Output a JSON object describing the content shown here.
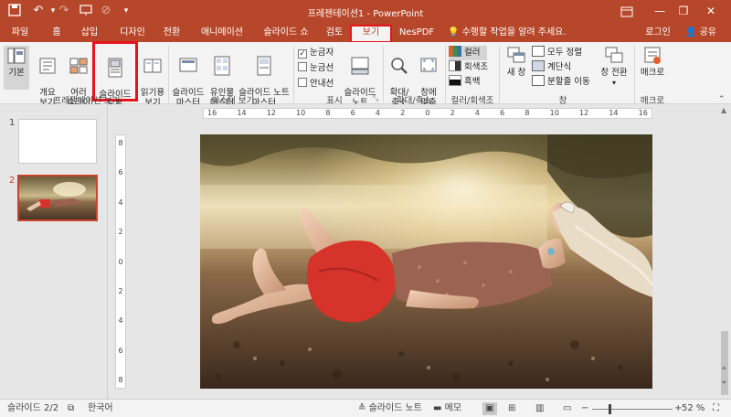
{
  "window": {
    "title": "프레젠테이션1 - PowerPoint",
    "controls": {
      "minimize": "—",
      "restore": "❐",
      "close": "✕"
    }
  },
  "tabs": [
    "파일",
    "홈",
    "삽입",
    "디자인",
    "전환",
    "애니메이션",
    "슬라이드 쇼",
    "검토",
    "보기",
    "NesPDF"
  ],
  "active_tab": "보기",
  "tell_me": "수행할 작업을 알려 주세요.",
  "account": {
    "login": "로그인",
    "share": "공유"
  },
  "ribbon": {
    "presentation_views": {
      "label": "프레젠테이션 보기",
      "buttons": [
        {
          "label": "기본"
        },
        {
          "label": "개요\n보기"
        },
        {
          "label": "여러\n슬라이드"
        },
        {
          "label": "슬라이드\n노트"
        },
        {
          "label": "읽기용\n보기"
        }
      ]
    },
    "master_views": {
      "label": "마스터 보기",
      "buttons": [
        {
          "label": "슬라이드\n마스터"
        },
        {
          "label": "유인물\n마스터"
        },
        {
          "label": "슬라이드 노트\n마스터"
        }
      ]
    },
    "show": {
      "label": "표시",
      "checks": [
        {
          "label": "눈금자",
          "checked": true
        },
        {
          "label": "눈금선",
          "checked": false
        },
        {
          "label": "안내선",
          "checked": false
        }
      ],
      "notes_button": "슬라이드\n노트"
    },
    "zoom": {
      "label": "확대/축소",
      "buttons": [
        {
          "label": "확대/\n축소"
        },
        {
          "label": "창에\n맞춤"
        }
      ]
    },
    "color": {
      "label": "컬러/회색조",
      "items": [
        {
          "label": "컬러",
          "color": "#e06030"
        },
        {
          "label": "회색조",
          "color": "#909090"
        },
        {
          "label": "흑백",
          "color": "#111111"
        }
      ]
    },
    "window": {
      "label": "창",
      "new_window": "새 창",
      "items": [
        "모두 정렬",
        "계단식",
        "분할줄 이동"
      ]
    },
    "switch_window": "창 전환",
    "macros": {
      "label": "매크로",
      "button": "매크로"
    }
  },
  "thumbnails": [
    {
      "number": "1"
    },
    {
      "number": "2"
    }
  ],
  "ruler": {
    "h_ticks": [
      "16",
      "14",
      "12",
      "10",
      "8",
      "6",
      "4",
      "2",
      "0",
      "2",
      "4",
      "6",
      "8",
      "10",
      "12",
      "14",
      "16"
    ],
    "v_ticks": [
      "8",
      "6",
      "4",
      "2",
      "0",
      "2",
      "4",
      "6",
      "8"
    ]
  },
  "status": {
    "slide_info": "슬라이드 2/2",
    "language": "한국어",
    "notes": "슬라이드 노트",
    "comments": "메모",
    "zoom": "52 %"
  },
  "colors": {
    "accent": "#b7472a",
    "highlight": "#e8141c"
  }
}
